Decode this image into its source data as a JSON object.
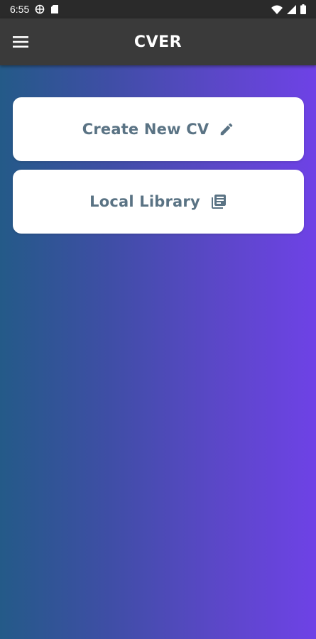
{
  "status_bar": {
    "time": "6:55",
    "icons": [
      "vpn-icon",
      "sd-card-icon",
      "wifi-icon",
      "signal-icon",
      "battery-icon"
    ]
  },
  "app_bar": {
    "title": "CVER",
    "menu_icon": "hamburger-menu-icon"
  },
  "main": {
    "cards": [
      {
        "label": "Create New CV",
        "icon": "pencil-icon"
      },
      {
        "label": "Local Library",
        "icon": "library-books-icon"
      }
    ]
  },
  "colors": {
    "status_bar_bg": "#2a2a2a",
    "app_bar_bg": "#3a3a3a",
    "gradient_start": "#245a88",
    "gradient_end": "#6e42e6",
    "card_bg": "#ffffff",
    "card_text": "#5a7384"
  }
}
